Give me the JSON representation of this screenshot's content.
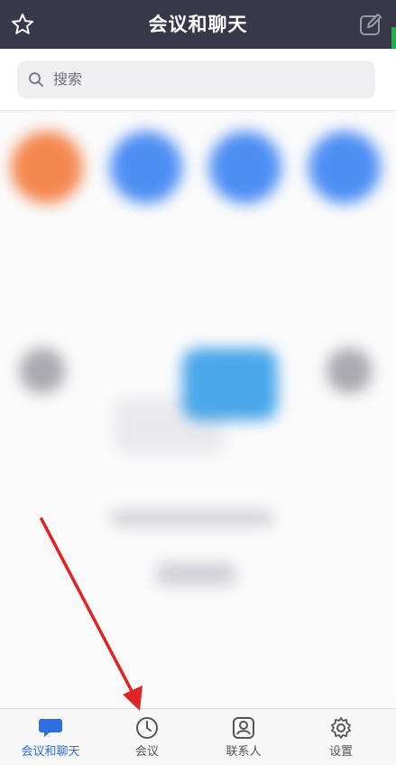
{
  "header": {
    "title": "会议和聊天"
  },
  "search": {
    "placeholder": "搜索"
  },
  "nav": [
    {
      "label": "会议和聊天",
      "icon": "chat-bubble-icon",
      "active": true
    },
    {
      "label": "会议",
      "icon": "clock-icon",
      "active": false
    },
    {
      "label": "联系人",
      "icon": "contact-icon",
      "active": false
    },
    {
      "label": "设置",
      "icon": "gear-icon",
      "active": false
    }
  ],
  "colors": {
    "header_bg": "#373849",
    "accent": "#2d6ee0",
    "arrow": "#e02424"
  }
}
